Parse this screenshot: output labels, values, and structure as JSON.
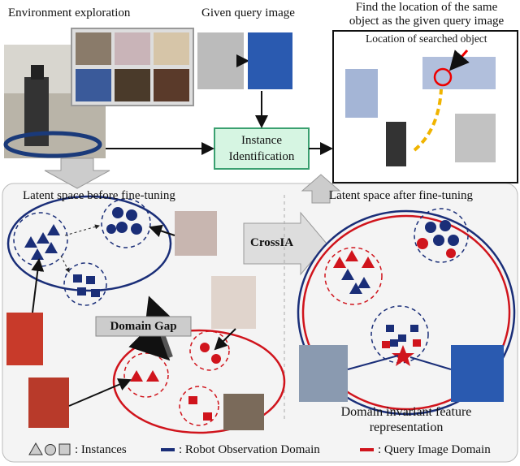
{
  "top": {
    "env_label": "Environment exploration",
    "query_label": "Given query image",
    "find_label_line1": "Find the location of the same",
    "find_label_line2": "object as the given query image",
    "searched_label": "Location of searched object",
    "instance_id_line1": "Instance",
    "instance_id_line2": "Identification"
  },
  "bottom": {
    "before_label": "Latent space before fine-tuning",
    "after_label": "Latent space after fine-tuning",
    "crossia_label": "CrossIA",
    "domain_gap_label": "Domain Gap",
    "invariant_line1": "Domain invariant feature",
    "invariant_line2": "representation"
  },
  "legend": {
    "instances": ": Instances",
    "robot_domain": ": Robot Observation Domain",
    "query_domain": ": Query Image Domain"
  },
  "colors": {
    "robot_domain": "#1a2e78",
    "query_domain": "#d0141c",
    "instance_box": "#d6f5e2"
  }
}
